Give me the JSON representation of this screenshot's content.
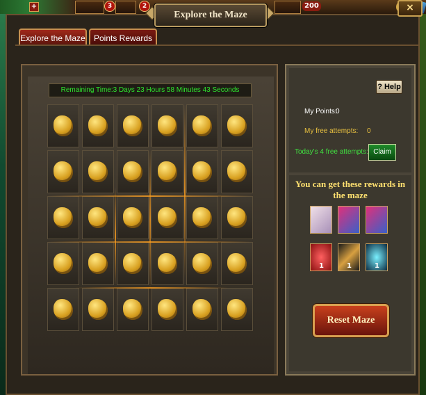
{
  "hud": {
    "plus_icon": "+",
    "badge_1": "3",
    "badge_2": "2",
    "count": "200"
  },
  "window": {
    "title": "Explore the Maze",
    "close_label": "×"
  },
  "tabs": [
    {
      "label": "Explore the Maze",
      "active": true
    },
    {
      "label": "Points Rewards",
      "active": false
    }
  ],
  "maze": {
    "remaining_time": "Remaining Time:3 Days 23 Hours 58 Minutes 43 Seconds",
    "rows": 5,
    "cols": 6,
    "cell_icon": "gold-ore-icon"
  },
  "stats": {
    "help_label": "? Help",
    "my_points_label": "My Points:",
    "my_points_value": "0",
    "free_attempts_label": "My free attempts:",
    "free_attempts_value": "0",
    "today_free_label": "Today's 4 free attempts:",
    "claim_label": "Claim"
  },
  "rewards": {
    "title": "You can get these rewards in the maze",
    "items": [
      {
        "icon": "hero-portrait-icon",
        "qty": ""
      },
      {
        "icon": "gift-box-icon",
        "qty": ""
      },
      {
        "icon": "gift-box-icon",
        "qty": ""
      },
      {
        "icon": "treasure-chest-icon",
        "qty": "1"
      },
      {
        "icon": "scroll-icon",
        "qty": "1"
      },
      {
        "icon": "crystal-shard-icon",
        "qty": "1"
      }
    ]
  },
  "reset_label": "Reset Maze",
  "colors": {
    "timer_text": "#2ee82e",
    "reward_title": "#ffe070",
    "my_points": "#ffffff",
    "free_attempts": "#e8c040",
    "today_free": "#40e040"
  }
}
